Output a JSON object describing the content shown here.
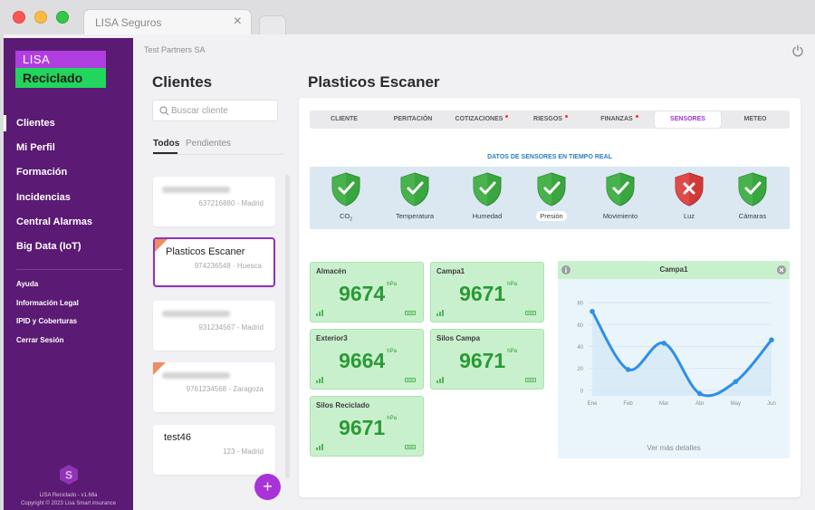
{
  "browser": {
    "tab_title": "LISA Seguros",
    "tab_close": "×"
  },
  "sidebar": {
    "logo_line1": "LISA",
    "logo_line2": "Reciclado",
    "nav": [
      "Clientes",
      "Mi Perfil",
      "Formación",
      "Incidencias",
      "Central Alarmas",
      "Big Data (IoT)"
    ],
    "links": [
      "Ayuda",
      "Información Legal",
      "IPID y Coberturas",
      "Cerrar Sesión"
    ],
    "version": "LISA Reciclado - v1.68a",
    "copyright": "Copyright © 2023 Lisa Smart insurance",
    "colors": {
      "bg": "#5b1a73",
      "logo_top": "#b13ee0",
      "logo_bottom": "#21d65d"
    }
  },
  "topbar": {
    "company": "Test Partners SA",
    "power_icon": "power-icon"
  },
  "clients": {
    "title": "Clientes",
    "search_placeholder": "Buscar cliente",
    "filters": {
      "all": "Todos",
      "pending": "Pendientes"
    },
    "cards": [
      {
        "name": "",
        "info": "637216880 - Madrid"
      },
      {
        "name": "Plasticos Escaner",
        "info": "974236548 - Huesca"
      },
      {
        "name": "",
        "info": "931234567 - Madrid"
      },
      {
        "name": "",
        "info": "9761234568 - Zaragoza"
      },
      {
        "name": "test46",
        "info": "123 - Madrid"
      }
    ],
    "add_label": "+"
  },
  "main": {
    "title": "Plasticos Escaner",
    "tabs": [
      "CLIENTE",
      "PERITACIÓN",
      "COTIZACIONES",
      "RIESGOS",
      "FINANZAS",
      "SENSORES",
      "METEO"
    ],
    "sensors_title": "DATOS DE SENSORES EN TIEMPO REAL",
    "sensors": {
      "co2": "CO",
      "co2_sub": "2",
      "others": [
        "Temperatura",
        "Humedad",
        "Presión",
        "Movimiento",
        "Luz",
        "Cámaras"
      ]
    },
    "tiles": [
      {
        "name": "Almacén",
        "value": "9674",
        "unit": "hPa"
      },
      {
        "name": "Campa1",
        "value": "9671",
        "unit": "hPa"
      },
      {
        "name": "Exterior3",
        "value": "9664",
        "unit": "hPa"
      },
      {
        "name": "Silos Campa",
        "value": "9671",
        "unit": "hPa"
      },
      {
        "name": "Silos Reciclado",
        "value": "9671",
        "unit": "hPa"
      }
    ],
    "chart_panel": {
      "title": "Campa1",
      "more": "Ver más detalles"
    },
    "colors": {
      "accent": "#a033d1",
      "ok": "#3aa63f",
      "alarm": "#d23a3a",
      "tile": "#c9f0cc",
      "line": "#2f8fe6"
    }
  },
  "chart_data": {
    "type": "line",
    "categories": [
      "Ene",
      "Feb",
      "Mar",
      "Abr",
      "May",
      "Jun"
    ],
    "values": [
      72,
      19,
      43,
      -3,
      8,
      46
    ],
    "yticks": [
      0,
      20,
      40,
      60,
      80
    ],
    "ylim": [
      -5,
      85
    ],
    "grid": true
  }
}
